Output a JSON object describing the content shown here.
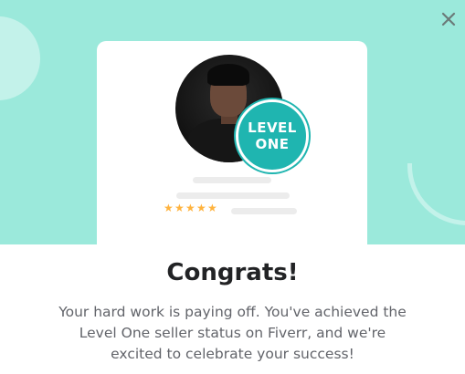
{
  "colors": {
    "hero_background": "#9be9db",
    "decoration": "#c3f2ea",
    "badge": "#1fb5b0",
    "star": "#ffb33e",
    "title_text": "#222325",
    "body_text": "#62646a"
  },
  "icons": {
    "close": "close-icon",
    "star": "star-icon"
  },
  "badge": {
    "line1": "LEVEL",
    "line2": "ONE"
  },
  "rating": {
    "stars": 5,
    "star_glyph": "★"
  },
  "dialog": {
    "title": "Congrats!",
    "message": "Your hard work is paying off. You've achieved the Level One seller status on Fiverr, and we're excited to celebrate your success!"
  }
}
